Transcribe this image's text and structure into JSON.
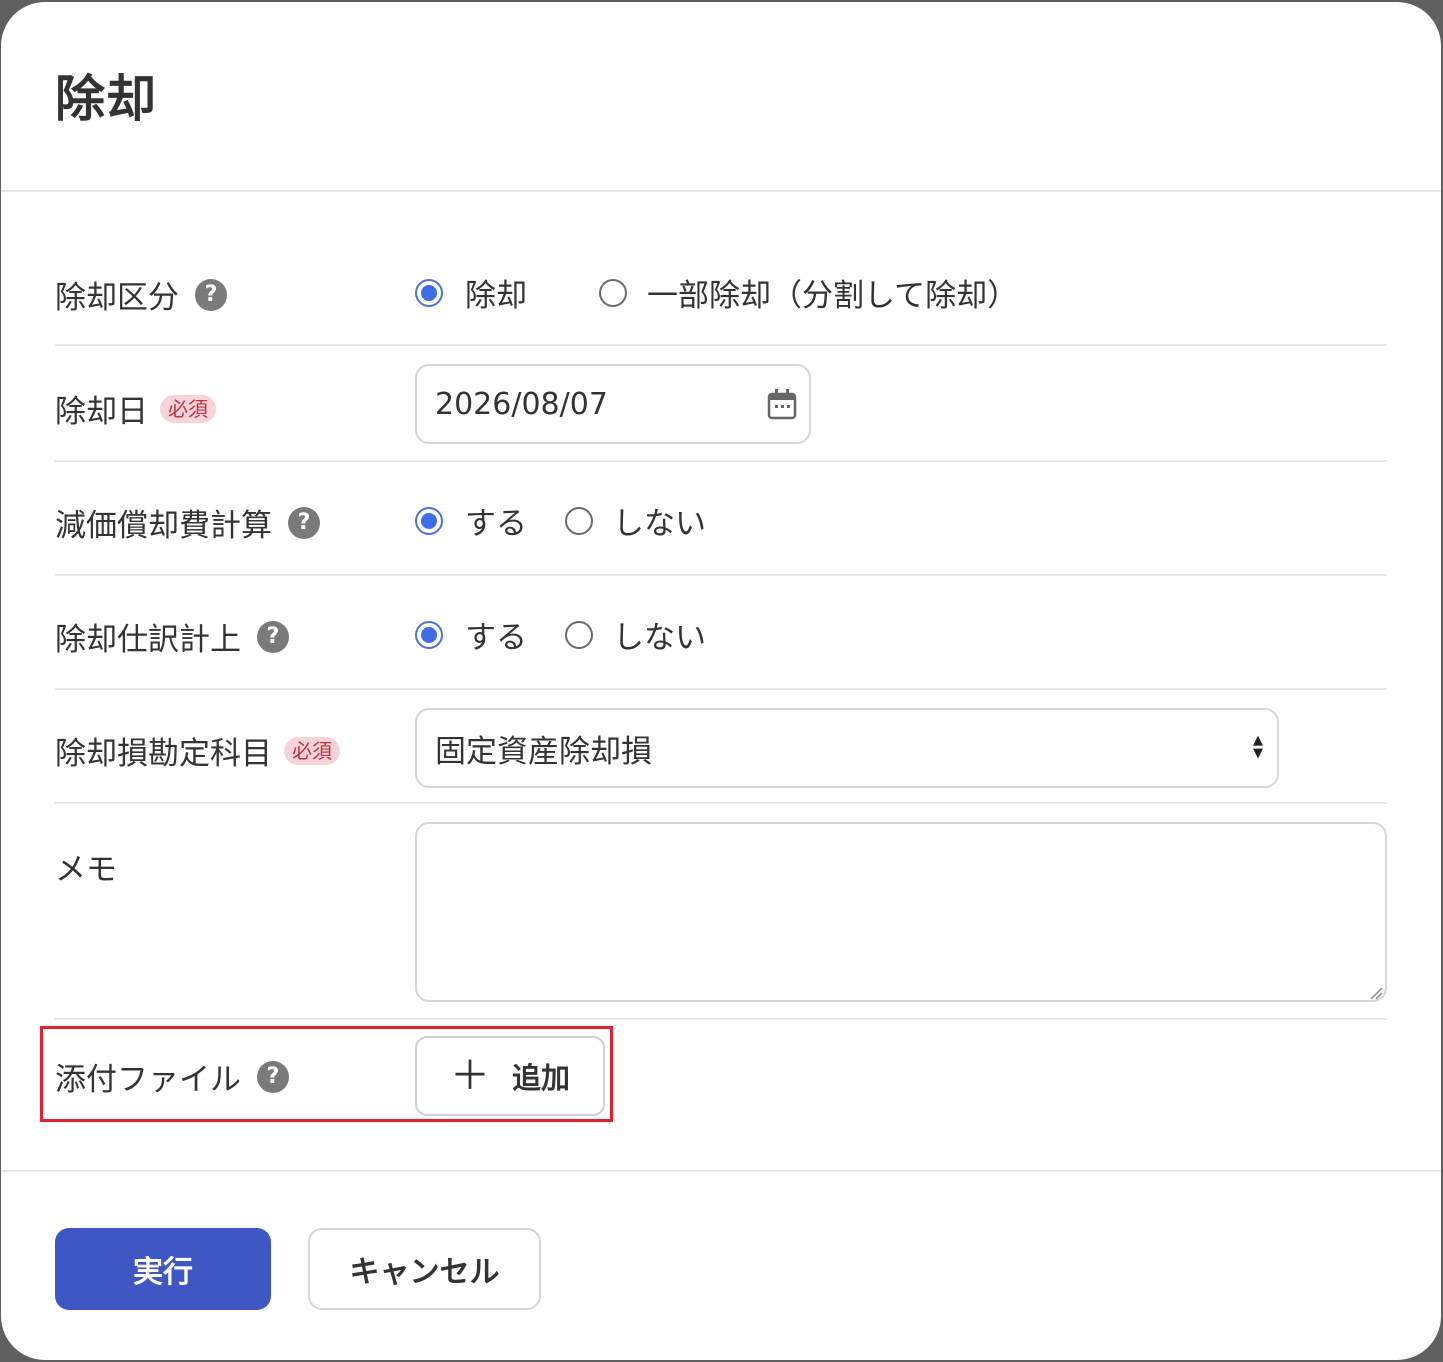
{
  "dialog": {
    "title": "除却"
  },
  "form": {
    "disposal_type": {
      "label": "除却区分",
      "help": "?",
      "options": [
        {
          "label": "除却",
          "checked": true
        },
        {
          "label": "一部除却（分割して除却）",
          "checked": false
        }
      ]
    },
    "disposal_date": {
      "label": "除却日",
      "required_badge": "必須",
      "value": "2026/08/07",
      "icon": "calendar-icon"
    },
    "depreciation_calc": {
      "label": "減価償却費計算",
      "help": "?",
      "options": [
        {
          "label": "する",
          "checked": true
        },
        {
          "label": "しない",
          "checked": false
        }
      ]
    },
    "disposal_journal": {
      "label": "除却仕訳計上",
      "help": "?",
      "options": [
        {
          "label": "する",
          "checked": true
        },
        {
          "label": "しない",
          "checked": false
        }
      ]
    },
    "loss_account": {
      "label": "除却損勘定科目",
      "required_badge": "必須",
      "selected": "固定資産除却損"
    },
    "memo": {
      "label": "メモ",
      "value": ""
    },
    "attachment": {
      "label": "添付ファイル",
      "help": "?",
      "add_button_icon": "＋",
      "add_button_label": "追加"
    }
  },
  "footer": {
    "execute_label": "実行",
    "cancel_label": "キャンセル"
  },
  "colors": {
    "primary": "#3f57c4",
    "radio_checked": "#3d6ee8",
    "required_bg": "#f7d4d8",
    "required_text": "#c03240",
    "highlight": "#e0232e"
  }
}
